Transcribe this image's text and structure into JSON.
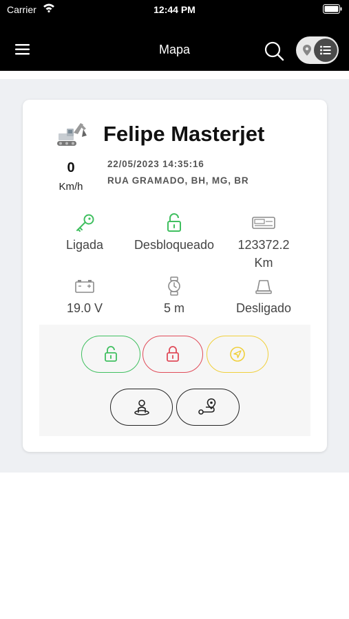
{
  "status_bar": {
    "carrier": "Carrier",
    "time": "12:44 PM"
  },
  "nav": {
    "title": "Mapa"
  },
  "vehicle": {
    "name": "Felipe Masterjet",
    "speed": "0",
    "speed_unit": "Km/h",
    "datetime": "22/05/2023 14:35:16",
    "address": "RUA GRAMADO, BH, MG, BR"
  },
  "stats": {
    "ignition": "Ligada",
    "lock": "Desbloqueado",
    "odometer": "123372.2",
    "odometer_unit": "Km",
    "voltage": "19.0 V",
    "time_stopped": "5 m",
    "siren": "Desligado"
  },
  "colors": {
    "green": "#3fbf5f",
    "red": "#e04a58",
    "yellow": "#f0cf3a",
    "gray": "#8a8a8a"
  },
  "icons": [
    "menu-icon",
    "search-icon",
    "map-pin-icon",
    "list-icon",
    "excavator-icon",
    "key-icon",
    "unlock-icon",
    "odometer-icon",
    "battery-icon",
    "watch-icon",
    "siren-icon",
    "lock-icon",
    "navigation-icon",
    "driver-icon",
    "route-icon"
  ]
}
